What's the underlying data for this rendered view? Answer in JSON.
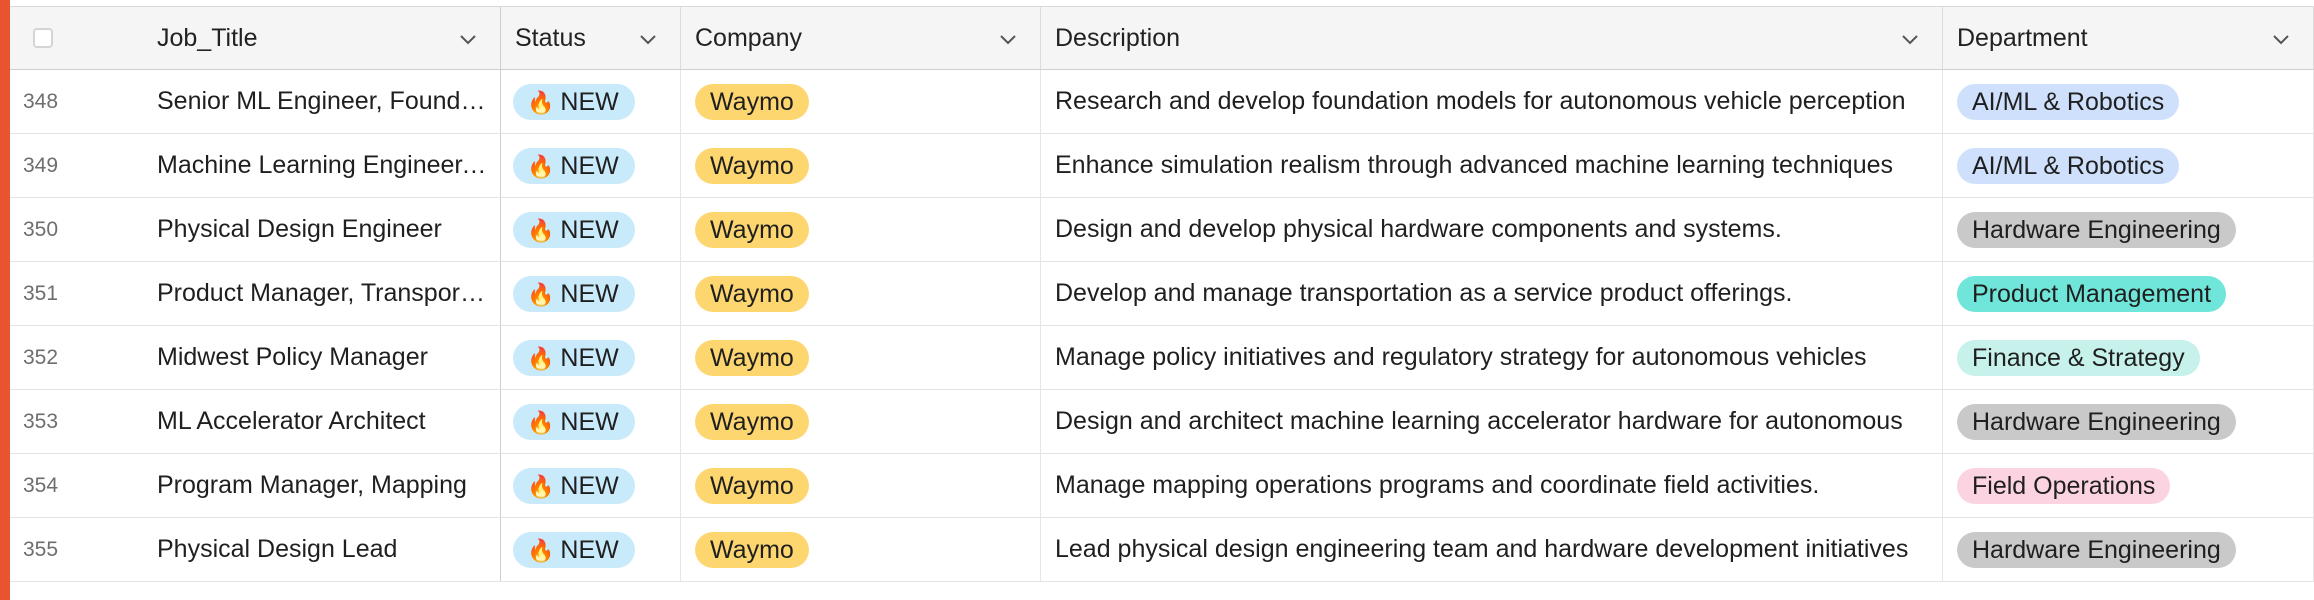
{
  "columns": {
    "job_title": "Job_Title",
    "status": "Status",
    "company": "Company",
    "description": "Description",
    "department": "Department"
  },
  "rows": [
    {
      "num": "348",
      "title": "Senior ML Engineer, Foundation Models",
      "status": "NEW",
      "company": "Waymo",
      "description": "Research and develop foundation models for autonomous vehicle perception",
      "department": "AI/ML & Robotics",
      "dept_color": "#cfe0fc"
    },
    {
      "num": "349",
      "title": "Machine Learning Engineer, Simulation",
      "status": "NEW",
      "company": "Waymo",
      "description": "Enhance simulation realism through advanced machine learning techniques",
      "department": "AI/ML & Robotics",
      "dept_color": "#cfe0fc"
    },
    {
      "num": "350",
      "title": "Physical Design Engineer",
      "status": "NEW",
      "company": "Waymo",
      "description": "Design and develop physical hardware components and systems.",
      "department": "Hardware Engineering",
      "dept_color": "#c9c9c9"
    },
    {
      "num": "351",
      "title": "Product Manager, Transportation",
      "status": "NEW",
      "company": "Waymo",
      "description": "Develop and manage transportation as a service product offerings.",
      "department": "Product Management",
      "dept_color": "#6fe6d9"
    },
    {
      "num": "352",
      "title": "Midwest Policy Manager",
      "status": "NEW",
      "company": "Waymo",
      "description": "Manage policy initiatives and regulatory strategy for autonomous vehicles",
      "department": "Finance & Strategy",
      "dept_color": "#c7f2ec"
    },
    {
      "num": "353",
      "title": "ML Accelerator Architect",
      "status": "NEW",
      "company": "Waymo",
      "description": "Design and architect machine learning accelerator hardware for autonomous",
      "department": "Hardware Engineering",
      "dept_color": "#c9c9c9"
    },
    {
      "num": "354",
      "title": "Program Manager, Mapping",
      "status": "NEW",
      "company": "Waymo",
      "description": "Manage mapping operations programs and coordinate field activities.",
      "department": "Field Operations",
      "dept_color": "#fcd3e1"
    },
    {
      "num": "355",
      "title": "Physical Design Lead",
      "status": "NEW",
      "company": "Waymo",
      "description": "Lead physical design engineering team and hardware development initiatives",
      "department": "Hardware Engineering",
      "dept_color": "#c9c9c9"
    }
  ],
  "icons": {
    "status_fire": "🔥"
  },
  "colors": {
    "accent": "#e8542e",
    "status_pill": "#c8eafb",
    "company_pill": "#fdd66f"
  }
}
